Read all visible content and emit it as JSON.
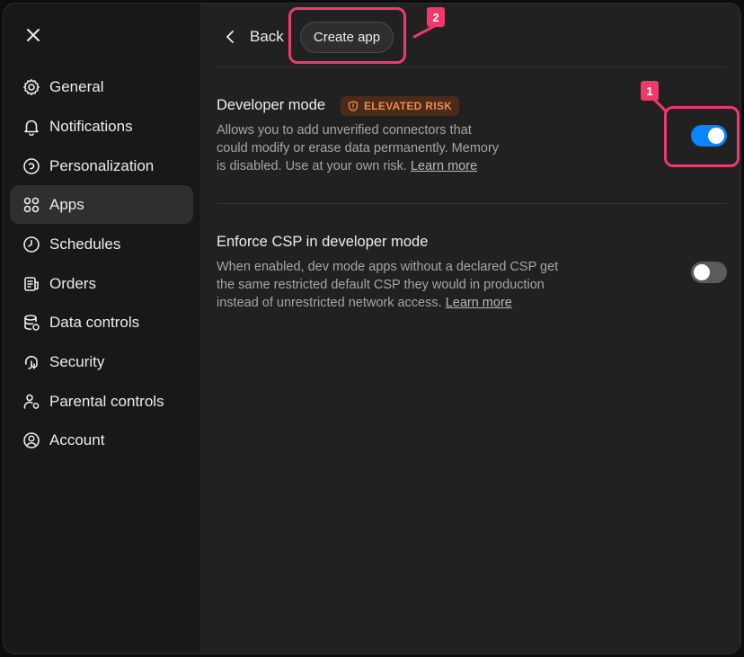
{
  "sidebar": {
    "close_icon": "close-icon",
    "items": [
      {
        "label": "General",
        "icon": "gear-icon",
        "active": false
      },
      {
        "label": "Notifications",
        "icon": "bell-icon",
        "active": false
      },
      {
        "label": "Personalization",
        "icon": "personalization-icon",
        "active": false
      },
      {
        "label": "Apps",
        "icon": "apps-grid-icon",
        "active": true
      },
      {
        "label": "Schedules",
        "icon": "clock-icon",
        "active": false
      },
      {
        "label": "Orders",
        "icon": "orders-icon",
        "active": false
      },
      {
        "label": "Data controls",
        "icon": "database-icon",
        "active": false
      },
      {
        "label": "Security",
        "icon": "fingerprint-icon",
        "active": false
      },
      {
        "label": "Parental controls",
        "icon": "parental-icon",
        "active": false
      },
      {
        "label": "Account",
        "icon": "account-icon",
        "active": false
      }
    ]
  },
  "header": {
    "back_label": "Back",
    "create_app_label": "Create app"
  },
  "settings": {
    "developer_mode": {
      "title": "Developer mode",
      "badge": "ELEVATED RISK",
      "desc_line1": "Allows you to add unverified connectors that",
      "desc_line2": "could modify or erase data permanently. Memory",
      "desc_line3": "is disabled. Use at your own risk. ",
      "link": "Learn more",
      "enabled": true
    },
    "enforce_csp": {
      "title": "Enforce CSP in developer mode",
      "desc_line1": "When enabled, dev mode apps without a declared CSP get",
      "desc_line2": "the same restricted default CSP they would in production",
      "desc_line3": "instead of unrestricted network access. ",
      "link": "Learn more",
      "enabled": false
    }
  },
  "annotations": {
    "marker_1": "1",
    "marker_2": "2",
    "color": "#f0396b"
  },
  "colors": {
    "accent": "#0a84ff",
    "risk": "#f28a4b"
  }
}
